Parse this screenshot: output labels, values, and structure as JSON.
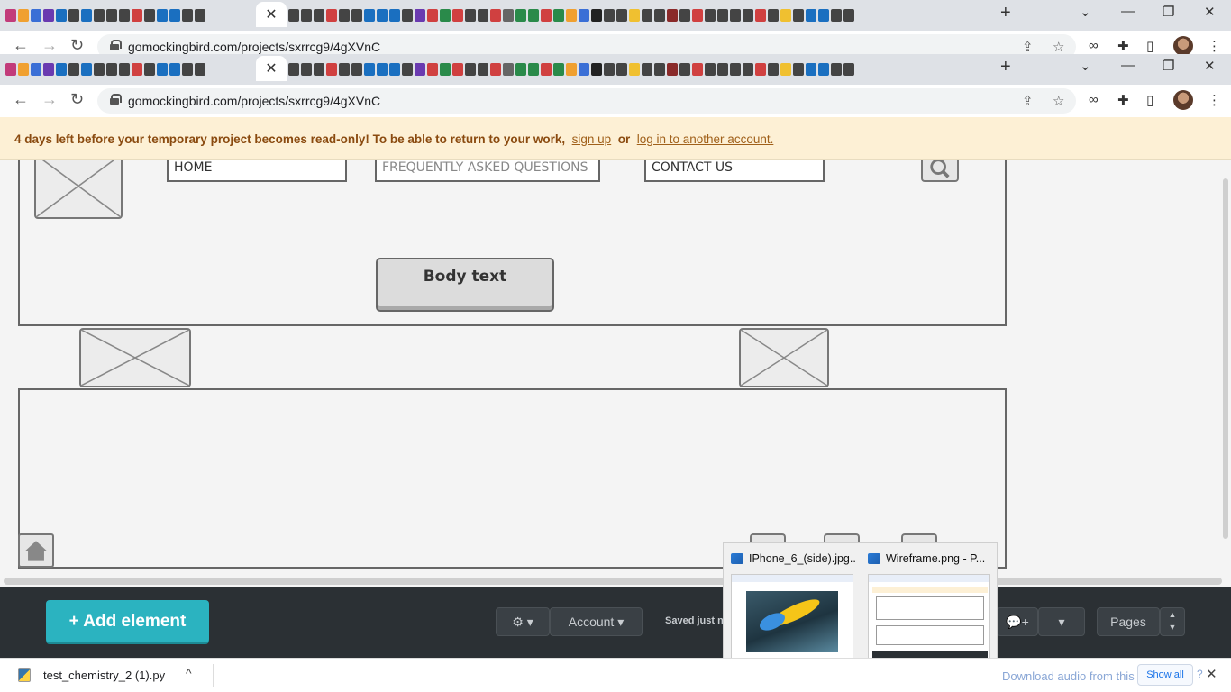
{
  "browser": {
    "new_tab_label": "+",
    "close_tab_label": "✕",
    "window_controls": {
      "minimize": "—",
      "maximize": "❐",
      "close": "✕",
      "tab_search": "⌄"
    },
    "nav": {
      "back": "←",
      "forward": "→",
      "reload": "↻"
    },
    "url": "gomockingbird.com/projects/sxrrcg9/4gXVnC",
    "favicon_colors": [
      "#c23b7a",
      "#f0a030",
      "#3b6fd6",
      "#6a3ab0",
      "#1a6fc0",
      "#444",
      "#1a6fc0",
      "#444",
      "#444",
      "#444",
      "#d04040",
      "#444",
      "#1a6fc0",
      "#1a6fc0",
      "#444",
      "#444"
    ],
    "favicon_colors_right": [
      "#444",
      "#444",
      "#444",
      "#d04040",
      "#444",
      "#444",
      "#1a6fc0",
      "#1a6fc0",
      "#1a6fc0",
      "#444",
      "#6a3ab0",
      "#d04040",
      "#2a8a4a",
      "#d04040",
      "#444",
      "#444",
      "#d04040",
      "#666",
      "#2a8a4a",
      "#2a8a4a",
      "#d04040",
      "#2a8a4a",
      "#f0a030",
      "#3b6fd6",
      "#222",
      "#444",
      "#444",
      "#f0c030",
      "#444",
      "#444",
      "#8a2a2a",
      "#444",
      "#d04040",
      "#444",
      "#444",
      "#444",
      "#444",
      "#d04040",
      "#444",
      "#f0c030",
      "#444",
      "#1a6fc0",
      "#1a6fc0",
      "#444",
      "#444"
    ]
  },
  "banner": {
    "message": "4 days left before your temporary project becomes read-only! To be able to return to your work,",
    "sign_up": "sign up",
    "or": "or",
    "login": "log in to another account."
  },
  "wireframe": {
    "nav_items": [
      "HOME",
      "FREQUENTLY ASKED QUESTIONS",
      "CONTACT US"
    ],
    "body_text": "Body text"
  },
  "toolbar": {
    "add_element": "+ Add element",
    "settings_caret": "▾",
    "account": "Account ▾",
    "saved": "Saved just no",
    "comment": "+",
    "caret": "▾",
    "pages": "Pages"
  },
  "preview": {
    "item1_title": "IPhone_6_(side).jpg...",
    "item2_title": "Wireframe.png - P..."
  },
  "downloads": {
    "file": "test_chemistry_2 (1).py",
    "caret": "^",
    "notice": "Download audio from this page",
    "show_all": "Show all",
    "help": "?",
    "close": "✕"
  }
}
